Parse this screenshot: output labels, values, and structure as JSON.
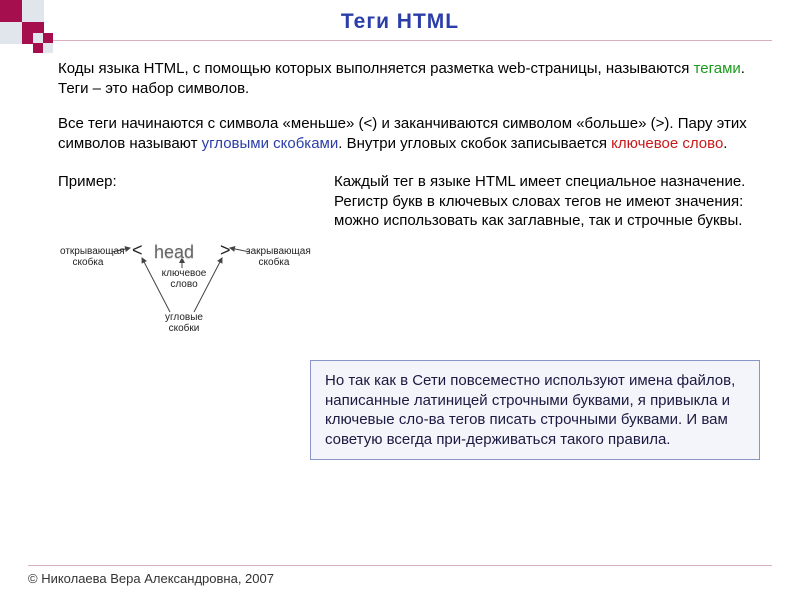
{
  "title": "Теги HTML",
  "intro": {
    "line1_a": "Коды языка HTML, с помощью которых выполняется разметка web-страницы, называются ",
    "tags_word": "тегами",
    "line1_b": ".",
    "line2": "Теги – это набор символов."
  },
  "para2": {
    "a": "Все теги начинаются с символа «меньше» (<) и заканчиваются символом «больше» (>). Пару этих символов называют ",
    "brackets_word": "угловыми скобками",
    "b": ". Внутри угловых скобок записывается ",
    "keyword_word": "ключевое слово",
    "c": "."
  },
  "example": {
    "label": "Пример:",
    "head": "head",
    "lt": "<",
    "gt": ">",
    "open_label": "открывающая скобка",
    "close_label": "закрывающая скобка",
    "keyword_label": "ключевое слово",
    "angle_label": "угловые скобки"
  },
  "right_text": "Каждый тег в языке HTML имеет специальное назначение. Регистр букв в ключевых словах тегов не имеют значения: можно использовать как заглавные, так и строчные буквы.",
  "note": "Но так как в Сети повсеместно используют имена файлов, написанные латиницей строчными буквами, я привыкла и ключевые сло-ва тегов писать строчными буквами. И вам советую всегда при-держиваться такого правила.",
  "footer": "© Николаева Вера Александровна, 2007"
}
